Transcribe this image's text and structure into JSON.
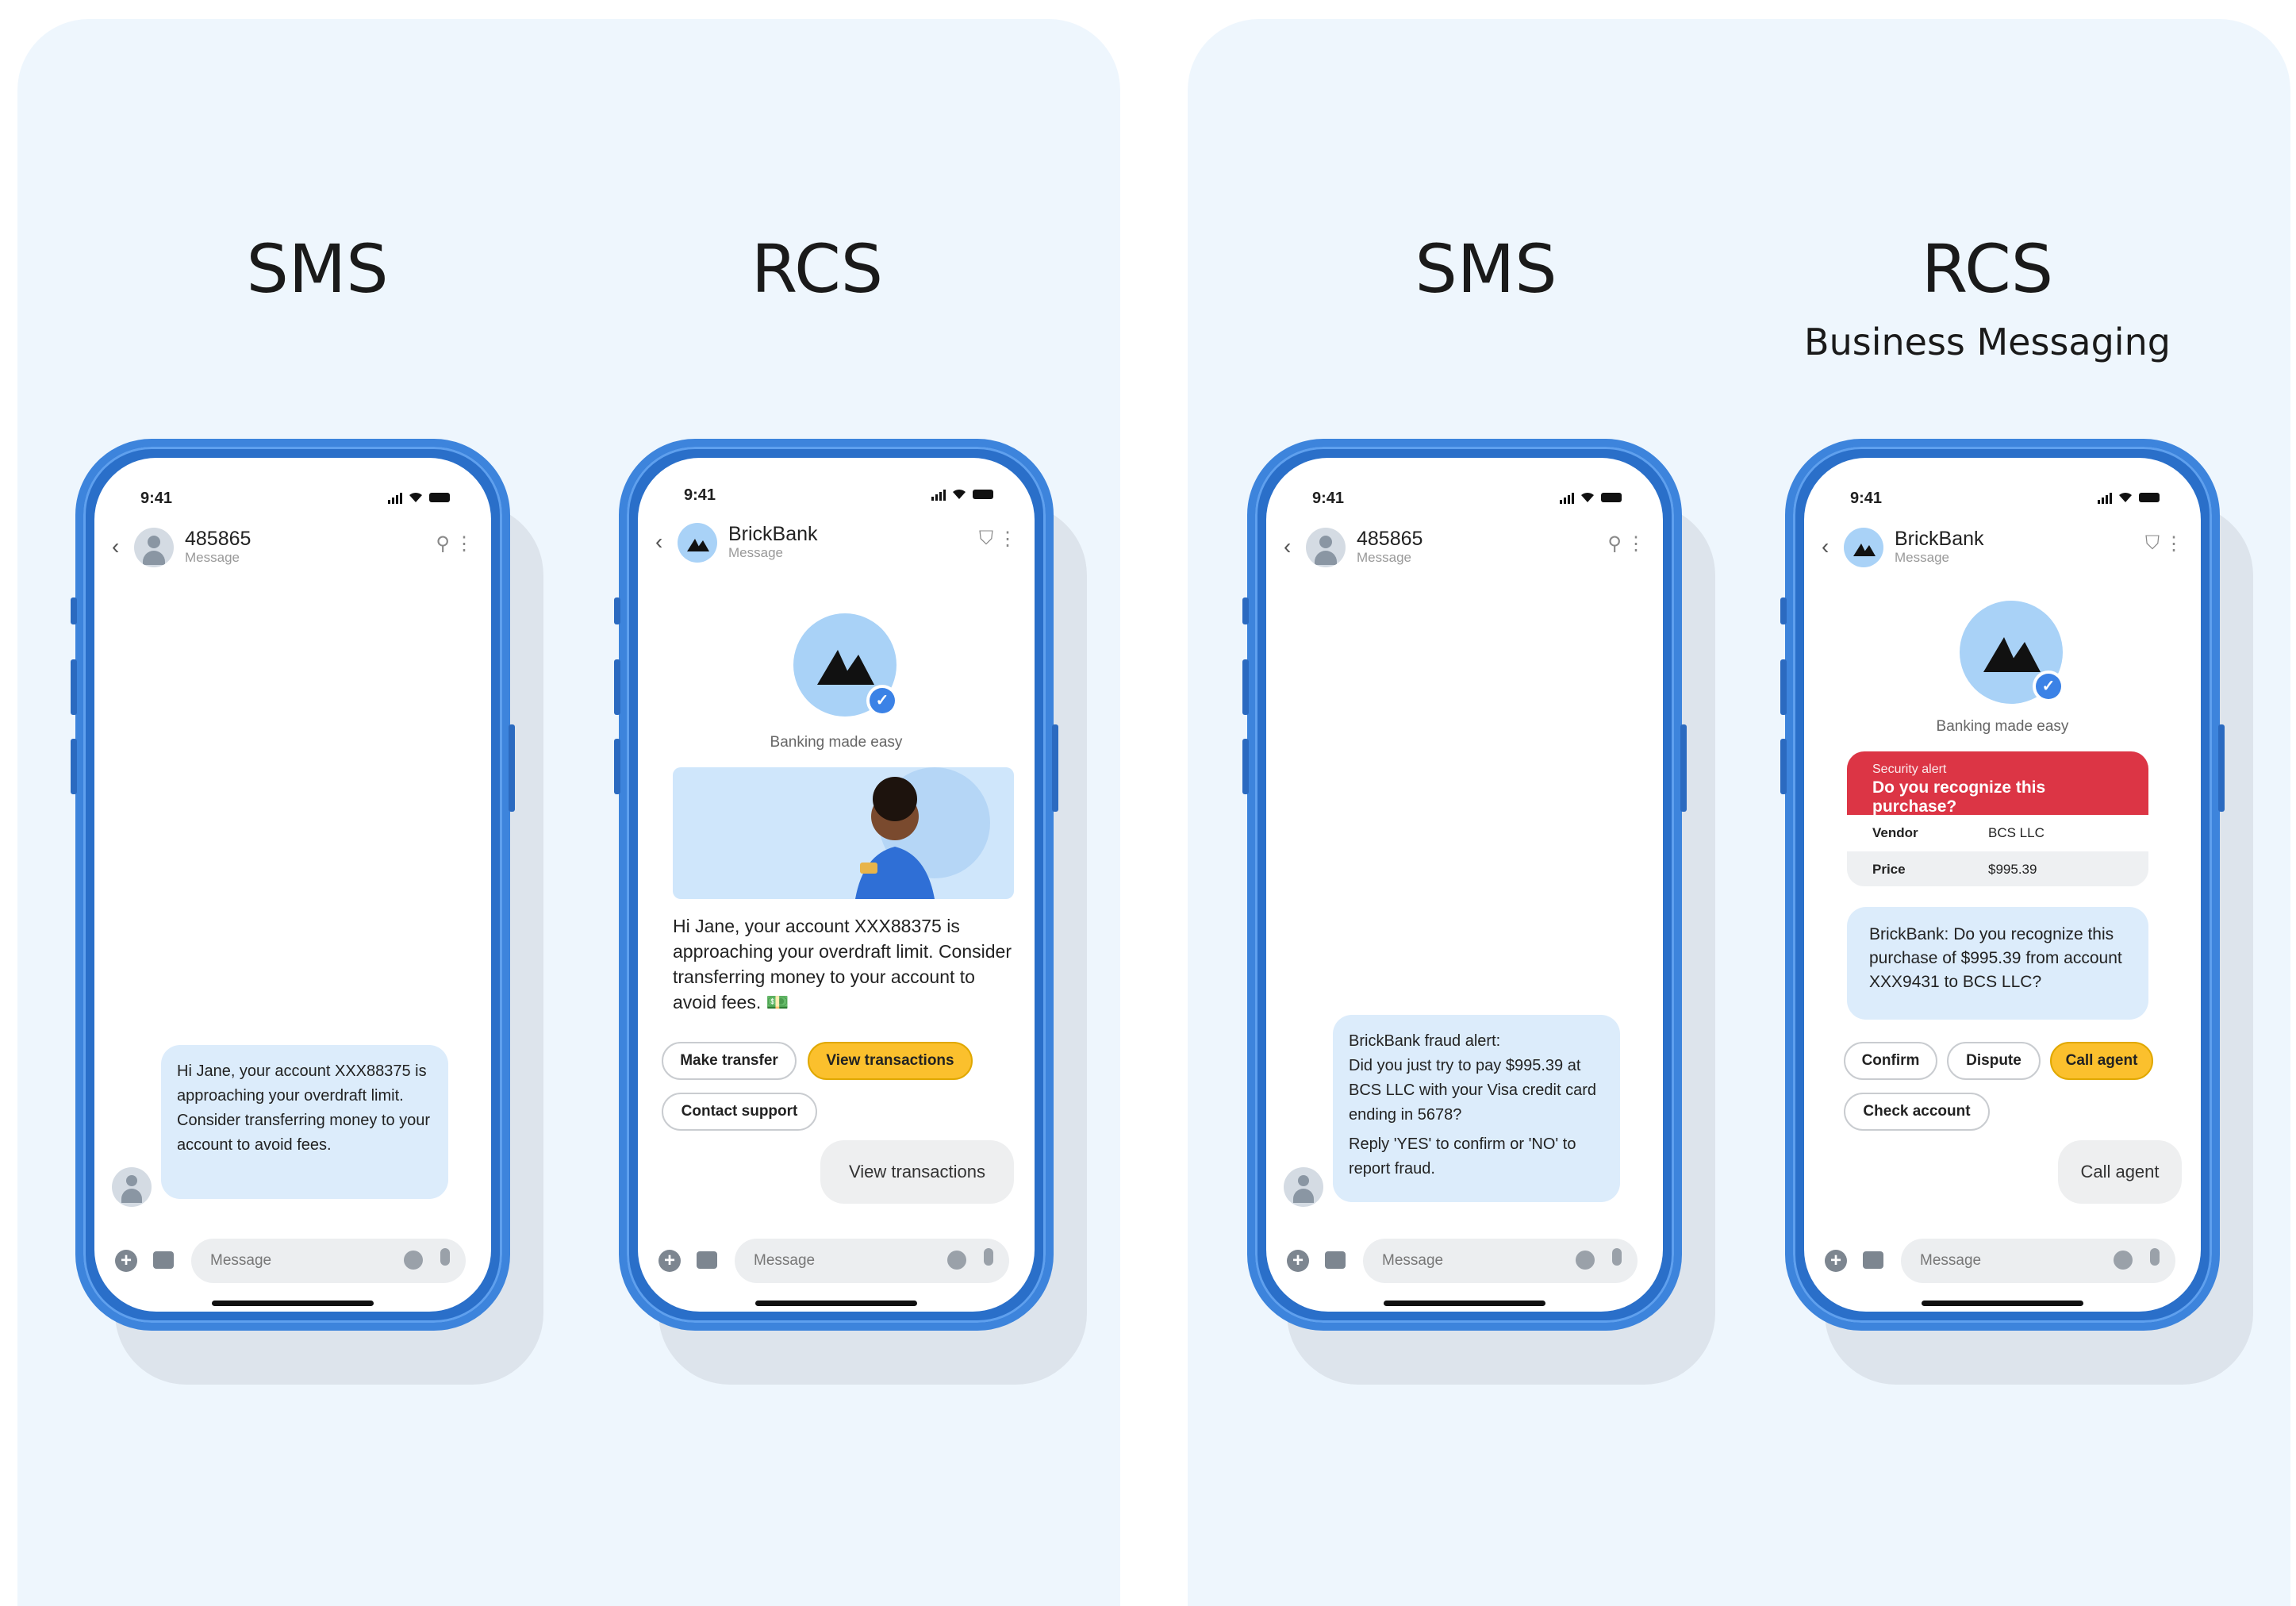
{
  "left_panel": {
    "sms_title": "SMS",
    "rcs_title": "RCS"
  },
  "right_panel": {
    "sms_title": "SMS",
    "rcs_title": "RCS",
    "rcs_subtitle": "Business Messaging"
  },
  "phones": {
    "p1": {
      "time": "9:41",
      "contact": "485865",
      "contact_sub": "Message",
      "message": "Hi Jane, your account XXX88375 is approaching your overdraft limit. Consider transferring money to your account to avoid fees.",
      "compose_placeholder": "Message"
    },
    "p2": {
      "time": "9:41",
      "contact": "BrickBank",
      "contact_sub": "Message",
      "tagline": "Banking made easy",
      "message": "Hi Jane, your account XXX88375 is approaching your overdraft limit. Consider transferring money to your account to avoid fees. 💵",
      "chips": [
        "Make transfer",
        "View transactions",
        "Contact support"
      ],
      "sent_reply": "View transactions",
      "compose_placeholder": "Message"
    },
    "p3": {
      "time": "9:41",
      "contact": "485865",
      "contact_sub": "Message",
      "message_line1": "BrickBank fraud alert:",
      "message_line2": "Did you just try to pay $995.39 at BCS LLC with your Visa credit card ending in 5678?",
      "message_line3": "Reply 'YES' to confirm or 'NO' to report fraud.",
      "compose_placeholder": "Message"
    },
    "p4": {
      "time": "9:41",
      "contact": "BrickBank",
      "contact_sub": "Message",
      "tagline": "Banking made easy",
      "alert_label": "Security alert",
      "alert_title": "Do you recognize this purchase?",
      "vendor_label": "Vendor",
      "vendor_value": "BCS LLC",
      "price_label": "Price",
      "price_value": "$995.39",
      "message": "BrickBank: Do you recognize this purchase of $995.39 from account XXX9431 to BCS LLC?",
      "chips": [
        "Confirm",
        "Dispute",
        "Call agent",
        "Check account"
      ],
      "sent_reply": "Call agent",
      "compose_placeholder": "Message"
    }
  },
  "colors": {
    "panel_bg": "#eef6fd",
    "phone_frame": "#3d84dc",
    "bubble_in": "#dcecfb",
    "accent_chip": "#fbc02d",
    "alert_red": "#dc3545"
  }
}
